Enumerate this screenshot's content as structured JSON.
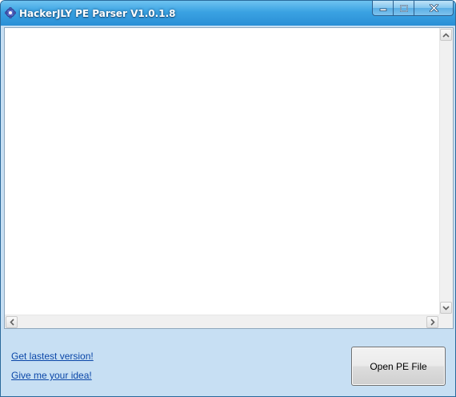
{
  "window": {
    "title": "HackerJLY PE Parser V1.0.1.8",
    "icon": "gear-icon",
    "caption_buttons": [
      "minimize-icon",
      "maximize-icon",
      "close-icon"
    ]
  },
  "output_text": "",
  "links": {
    "update": "Get lastest version!",
    "idea": "Give me your idea!"
  },
  "buttons": {
    "open": "Open PE File"
  },
  "colors": {
    "titlebar": "#3aa2e2",
    "panel": "#c7dff3",
    "link": "#0b47a8"
  }
}
